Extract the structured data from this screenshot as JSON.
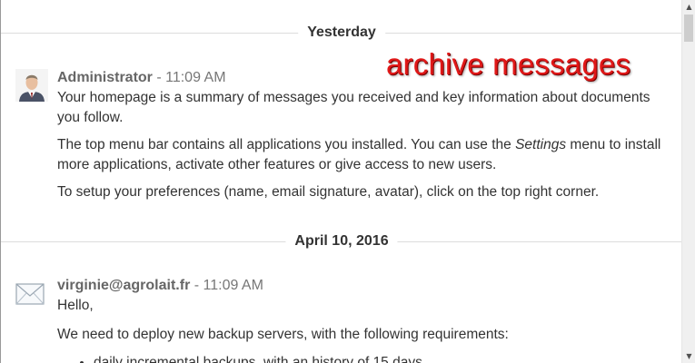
{
  "annotation": "archive messages",
  "separators": [
    "Yesterday",
    "April 10, 2016"
  ],
  "messages": [
    {
      "author": "Administrator",
      "sep": " - ",
      "time": "11:09 AM",
      "para1": "Your homepage is a summary of messages you received and key information about documents you follow.",
      "para2_before": "The top menu bar contains all applications you installed. You can use the ",
      "para2_em": "Settings",
      "para2_after": " menu to install more applications, activate other features or give access to new users.",
      "para3": "To setup your preferences (name, email signature, avatar), click on the top right corner."
    },
    {
      "author": "virginie@agrolait.fr",
      "sep": " - ",
      "time": "11:09 AM",
      "greeting": "Hello,",
      "para1": "We need to deploy new backup servers, with the following requirements:",
      "bullet1": "daily incremental backups, with an history of 15 days"
    }
  ],
  "icons": {
    "avatar": "person-avatar-icon",
    "email": "envelope-icon",
    "scroll_up": "arrow-up-icon",
    "scroll_down": "arrow-down-icon"
  },
  "colors": {
    "annotation": "#e01818",
    "author": "#666666",
    "text": "#333333",
    "separator_line": "#dcdcdc"
  }
}
